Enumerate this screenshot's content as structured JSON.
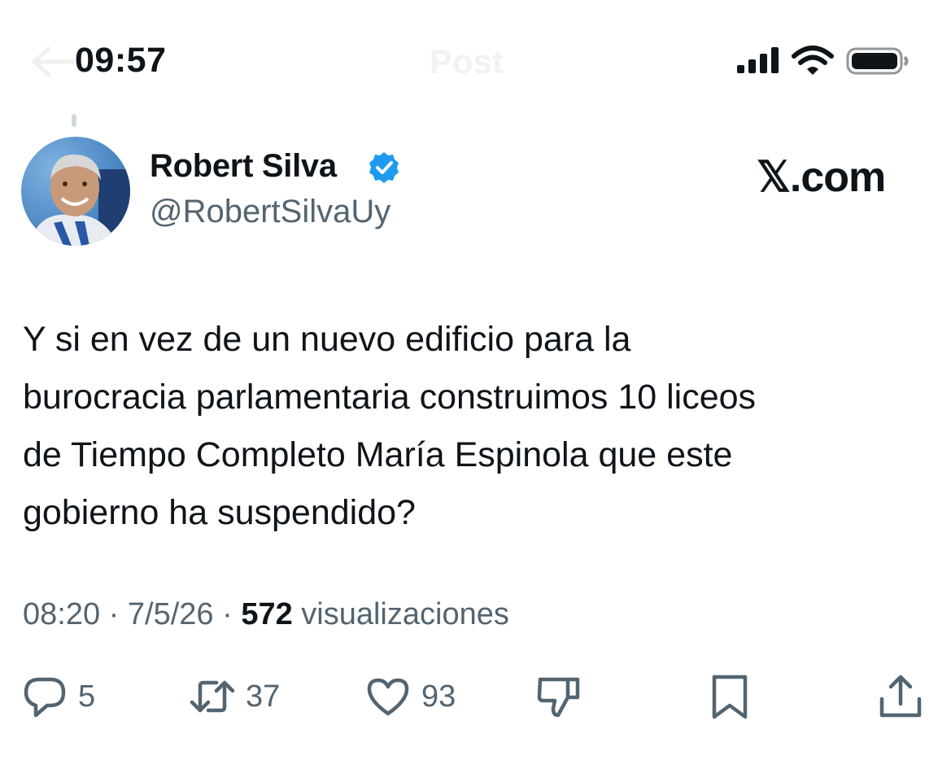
{
  "status_bar": {
    "time": "09:57",
    "icons": [
      "signal-icon",
      "wifi-icon",
      "battery-icon"
    ]
  },
  "nav": {
    "title": "Post",
    "back_icon": "back-arrow-icon"
  },
  "author": {
    "display_name": "Robert Silva",
    "handle": "@RobertSilvaUy",
    "verified": true,
    "verified_color": "#1d9bf0"
  },
  "brand": "𝕏.com",
  "post": {
    "text": "Y si en vez de un nuevo edificio para la\nburocracia parlamentaria construimos 10 liceos\nde Tiempo Completo María Espinola que este\ngobierno ha suspendido?",
    "time": "08:20",
    "date": "7/5/26",
    "separator": "·",
    "views_count": "572",
    "views_label": "visualizaciones"
  },
  "actions": {
    "reply": {
      "icon": "reply-icon",
      "count": "5"
    },
    "repost": {
      "icon": "repost-icon",
      "count": "37"
    },
    "like": {
      "icon": "heart-icon",
      "count": "93"
    },
    "dislike": {
      "icon": "dislike-icon"
    },
    "bookmark": {
      "icon": "bookmark-icon"
    },
    "share": {
      "icon": "share-icon"
    }
  },
  "colors": {
    "text": "#0f1419",
    "secondary": "#536471",
    "accent": "#1d9bf0"
  }
}
